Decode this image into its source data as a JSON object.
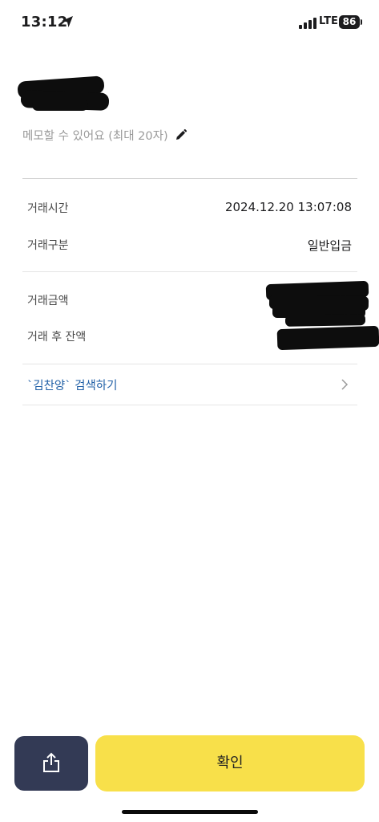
{
  "status_bar": {
    "time": "13:12",
    "network": "LTE",
    "battery": "86"
  },
  "header": {
    "memo_placeholder": "메모할 수 있어요 (최대 20자)"
  },
  "details": {
    "rows": [
      {
        "label": "거래시간",
        "value": "2024.12.20 13:07:08"
      },
      {
        "label": "거래구분",
        "value": "일반입금"
      },
      {
        "label": "거래금액",
        "value": ""
      },
      {
        "label": "거래 후 잔액",
        "value": ""
      }
    ]
  },
  "search_link": "`김찬양` 검색하기",
  "footer": {
    "confirm_label": "확인"
  },
  "colors": {
    "confirm_bg": "#f8e04a",
    "share_bg": "#333a55",
    "link": "#1f5fa6"
  }
}
